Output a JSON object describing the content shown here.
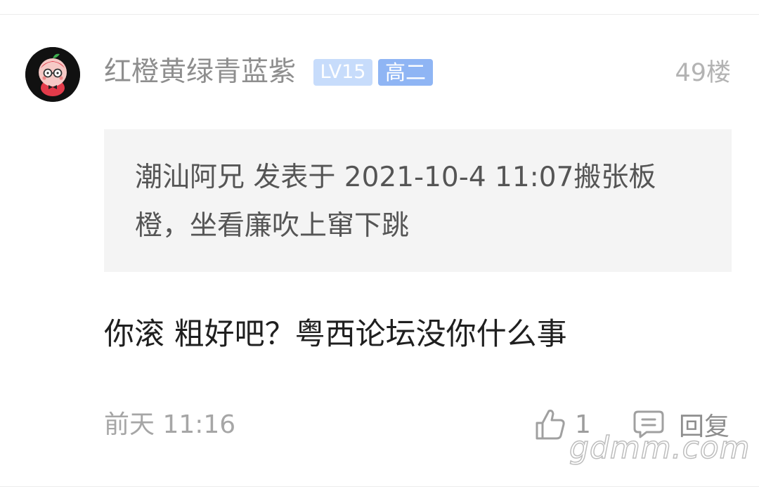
{
  "comment": {
    "username": "红橙黄绿青蓝紫",
    "level_badge": "LV15",
    "grade_badge": "高二",
    "floor": "49楼",
    "quote": "潮汕阿兄 发表于 2021-10-4 11:07搬张板橙，坐看廉吹上窜下跳",
    "content": "你滚 粗好吧？粤西论坛没你什么事",
    "time": "前天 11:16",
    "like_count": "1",
    "reply_label": "回复"
  },
  "watermark": "gdmm.com",
  "colors": {
    "level_badge_bg": "#c7dcfb",
    "grade_badge_bg": "#8fb5f4",
    "quote_bg": "#f4f4f4",
    "avatar_bg": "#111111"
  }
}
